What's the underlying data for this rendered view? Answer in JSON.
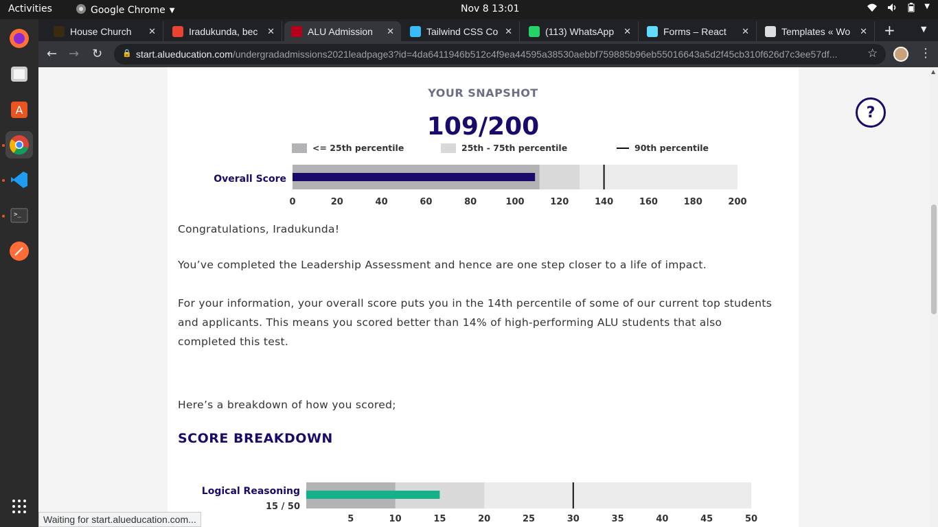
{
  "system": {
    "activities": "Activities",
    "app_name": "Google Chrome",
    "clock": "Nov 8  13:01"
  },
  "tabs": [
    {
      "label": "House Church",
      "fav_color": "#3a2a10",
      "active": false
    },
    {
      "label": "Iradukunda, bec",
      "fav_color": "#ea4335",
      "active": false
    },
    {
      "label": "ALU Admission",
      "fav_color": "#b3001b",
      "active": true
    },
    {
      "label": "Tailwind CSS Co",
      "fav_color": "#38bdf8",
      "active": false
    },
    {
      "label": "(113) WhatsApp",
      "fav_color": "#25d366",
      "active": false
    },
    {
      "label": "Forms – React",
      "fav_color": "#61dafb",
      "active": false
    },
    {
      "label": "Templates « Wo",
      "fav_color": "#dddddd",
      "active": false
    }
  ],
  "url": {
    "host": "start.alueducation.com",
    "path": "/undergradadmissions2021leadpage3?id=4da6411946b512c4f9ea44595a38530aebbf759885b96eb55016643a5d2f45cb310f626d7c3ee57df..."
  },
  "snapshot": {
    "title": "YOUR SNAPSHOT",
    "score": "109/200"
  },
  "legend": {
    "low": "<= 25th percentile",
    "mid": "25th - 75th percentile",
    "high": "90th percentile"
  },
  "colors": {
    "low_band": "#b3b3b5",
    "mid_band": "#d9d9d9",
    "rest_band": "#ececec",
    "overall_bar": "#1a0a6a",
    "logical_bar": "#16b08a",
    "brand": "#1a0a6a"
  },
  "content": {
    "congrats": "Congratulations, Iradukunda!",
    "completed": "You’ve completed the Leadership Assessment and hence are one step closer to a life of impact.",
    "info": "For your information, your overall score puts you in the 14th percentile of some of our current top students and applicants. This means you scored better than 14% of high-performing ALU students that also completed this test.",
    "breakdown_intro": "Here’s a breakdown of how you scored;",
    "breakdown_title": "SCORE BREAKDOWN"
  },
  "help_label": "?",
  "status": "Waiting for start.alueducation.com...",
  "chart_data": [
    {
      "type": "bar",
      "label": "Overall Score",
      "value": 109,
      "xlim": [
        0,
        200
      ],
      "ticks": [
        0,
        20,
        40,
        60,
        80,
        100,
        120,
        140,
        160,
        180,
        200
      ],
      "percentile_25": 111,
      "percentile_75": 129,
      "percentile_90": 140
    },
    {
      "type": "bar",
      "label": "Logical Reasoning",
      "value_label": "15 / 50",
      "value": 15,
      "xlim": [
        0,
        50
      ],
      "ticks": [
        5,
        10,
        15,
        20,
        25,
        30,
        35,
        40,
        45,
        50
      ],
      "percentile_25": 10,
      "percentile_75": 20,
      "percentile_90": 30
    }
  ]
}
